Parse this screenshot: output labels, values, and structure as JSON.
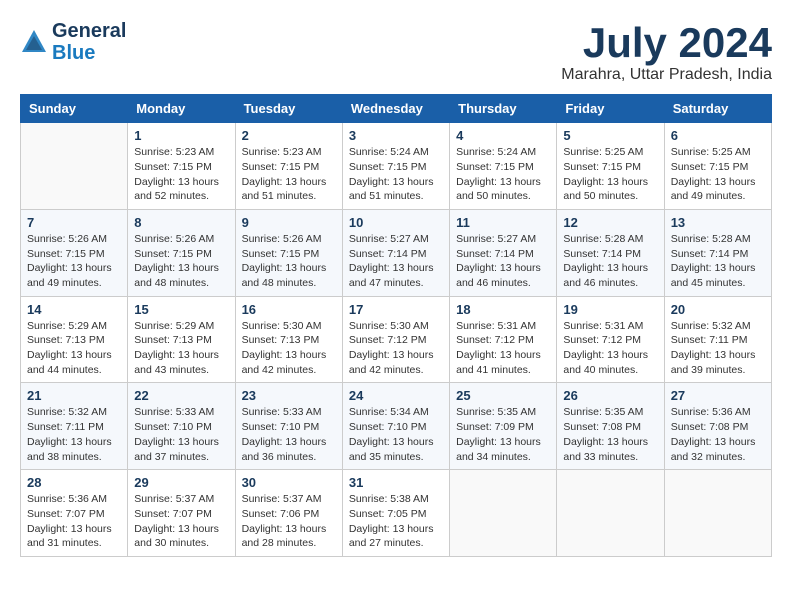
{
  "header": {
    "logo_line1": "General",
    "logo_line2": "Blue",
    "month_year": "July 2024",
    "location": "Marahra, Uttar Pradesh, India"
  },
  "weekdays": [
    "Sunday",
    "Monday",
    "Tuesday",
    "Wednesday",
    "Thursday",
    "Friday",
    "Saturday"
  ],
  "weeks": [
    [
      {
        "day": "",
        "info": ""
      },
      {
        "day": "1",
        "info": "Sunrise: 5:23 AM\nSunset: 7:15 PM\nDaylight: 13 hours\nand 52 minutes."
      },
      {
        "day": "2",
        "info": "Sunrise: 5:23 AM\nSunset: 7:15 PM\nDaylight: 13 hours\nand 51 minutes."
      },
      {
        "day": "3",
        "info": "Sunrise: 5:24 AM\nSunset: 7:15 PM\nDaylight: 13 hours\nand 51 minutes."
      },
      {
        "day": "4",
        "info": "Sunrise: 5:24 AM\nSunset: 7:15 PM\nDaylight: 13 hours\nand 50 minutes."
      },
      {
        "day": "5",
        "info": "Sunrise: 5:25 AM\nSunset: 7:15 PM\nDaylight: 13 hours\nand 50 minutes."
      },
      {
        "day": "6",
        "info": "Sunrise: 5:25 AM\nSunset: 7:15 PM\nDaylight: 13 hours\nand 49 minutes."
      }
    ],
    [
      {
        "day": "7",
        "info": "Sunrise: 5:26 AM\nSunset: 7:15 PM\nDaylight: 13 hours\nand 49 minutes."
      },
      {
        "day": "8",
        "info": "Sunrise: 5:26 AM\nSunset: 7:15 PM\nDaylight: 13 hours\nand 48 minutes."
      },
      {
        "day": "9",
        "info": "Sunrise: 5:26 AM\nSunset: 7:15 PM\nDaylight: 13 hours\nand 48 minutes."
      },
      {
        "day": "10",
        "info": "Sunrise: 5:27 AM\nSunset: 7:14 PM\nDaylight: 13 hours\nand 47 minutes."
      },
      {
        "day": "11",
        "info": "Sunrise: 5:27 AM\nSunset: 7:14 PM\nDaylight: 13 hours\nand 46 minutes."
      },
      {
        "day": "12",
        "info": "Sunrise: 5:28 AM\nSunset: 7:14 PM\nDaylight: 13 hours\nand 46 minutes."
      },
      {
        "day": "13",
        "info": "Sunrise: 5:28 AM\nSunset: 7:14 PM\nDaylight: 13 hours\nand 45 minutes."
      }
    ],
    [
      {
        "day": "14",
        "info": "Sunrise: 5:29 AM\nSunset: 7:13 PM\nDaylight: 13 hours\nand 44 minutes."
      },
      {
        "day": "15",
        "info": "Sunrise: 5:29 AM\nSunset: 7:13 PM\nDaylight: 13 hours\nand 43 minutes."
      },
      {
        "day": "16",
        "info": "Sunrise: 5:30 AM\nSunset: 7:13 PM\nDaylight: 13 hours\nand 42 minutes."
      },
      {
        "day": "17",
        "info": "Sunrise: 5:30 AM\nSunset: 7:12 PM\nDaylight: 13 hours\nand 42 minutes."
      },
      {
        "day": "18",
        "info": "Sunrise: 5:31 AM\nSunset: 7:12 PM\nDaylight: 13 hours\nand 41 minutes."
      },
      {
        "day": "19",
        "info": "Sunrise: 5:31 AM\nSunset: 7:12 PM\nDaylight: 13 hours\nand 40 minutes."
      },
      {
        "day": "20",
        "info": "Sunrise: 5:32 AM\nSunset: 7:11 PM\nDaylight: 13 hours\nand 39 minutes."
      }
    ],
    [
      {
        "day": "21",
        "info": "Sunrise: 5:32 AM\nSunset: 7:11 PM\nDaylight: 13 hours\nand 38 minutes."
      },
      {
        "day": "22",
        "info": "Sunrise: 5:33 AM\nSunset: 7:10 PM\nDaylight: 13 hours\nand 37 minutes."
      },
      {
        "day": "23",
        "info": "Sunrise: 5:33 AM\nSunset: 7:10 PM\nDaylight: 13 hours\nand 36 minutes."
      },
      {
        "day": "24",
        "info": "Sunrise: 5:34 AM\nSunset: 7:10 PM\nDaylight: 13 hours\nand 35 minutes."
      },
      {
        "day": "25",
        "info": "Sunrise: 5:35 AM\nSunset: 7:09 PM\nDaylight: 13 hours\nand 34 minutes."
      },
      {
        "day": "26",
        "info": "Sunrise: 5:35 AM\nSunset: 7:08 PM\nDaylight: 13 hours\nand 33 minutes."
      },
      {
        "day": "27",
        "info": "Sunrise: 5:36 AM\nSunset: 7:08 PM\nDaylight: 13 hours\nand 32 minutes."
      }
    ],
    [
      {
        "day": "28",
        "info": "Sunrise: 5:36 AM\nSunset: 7:07 PM\nDaylight: 13 hours\nand 31 minutes."
      },
      {
        "day": "29",
        "info": "Sunrise: 5:37 AM\nSunset: 7:07 PM\nDaylight: 13 hours\nand 30 minutes."
      },
      {
        "day": "30",
        "info": "Sunrise: 5:37 AM\nSunset: 7:06 PM\nDaylight: 13 hours\nand 28 minutes."
      },
      {
        "day": "31",
        "info": "Sunrise: 5:38 AM\nSunset: 7:05 PM\nDaylight: 13 hours\nand 27 minutes."
      },
      {
        "day": "",
        "info": ""
      },
      {
        "day": "",
        "info": ""
      },
      {
        "day": "",
        "info": ""
      }
    ]
  ]
}
